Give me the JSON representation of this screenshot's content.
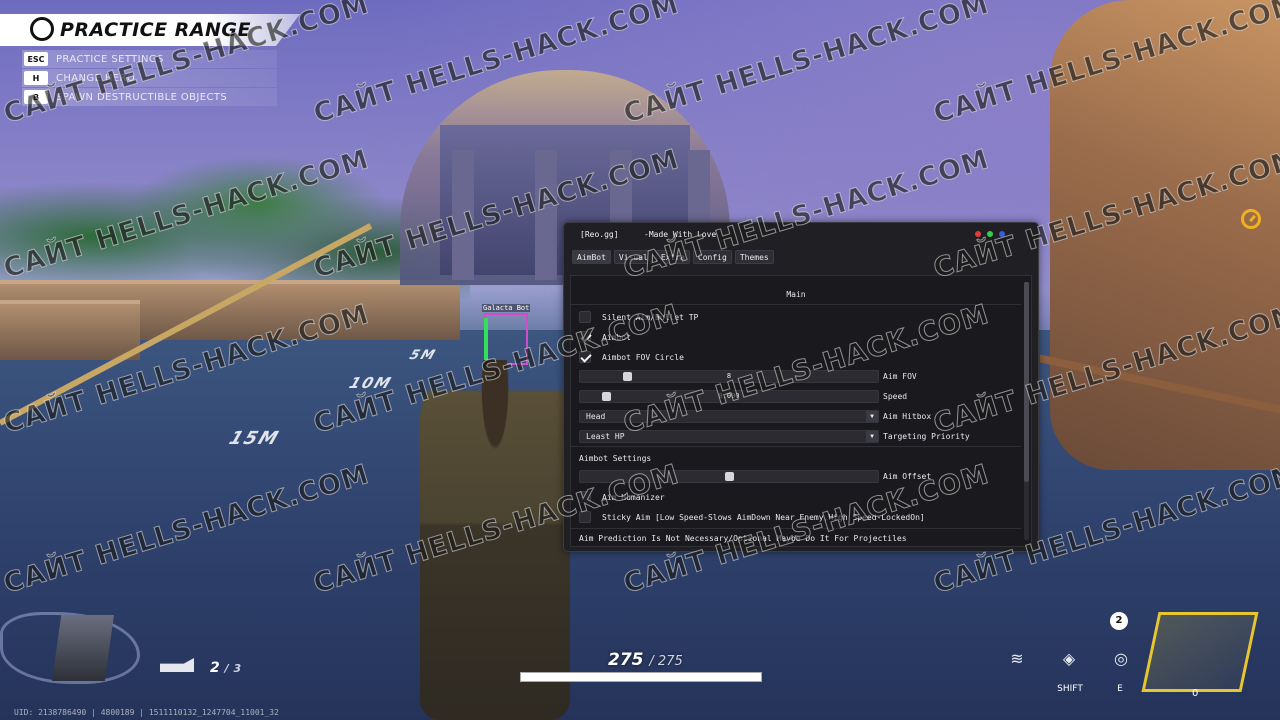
{
  "practice": {
    "title": "PRACTICE RANGE",
    "rows": [
      {
        "key": "ESC",
        "label": "PRACTICE SETTINGS"
      },
      {
        "key": "H",
        "label": "CHANGE HERO"
      },
      {
        "key": "B",
        "label": "SPAWN DESTRUCTIBLE OBJECTS"
      }
    ]
  },
  "floor_marks": {
    "m1": "5M",
    "m2": "10M",
    "m3": "15M"
  },
  "target": {
    "name": "Galacta Bot"
  },
  "menu": {
    "brand": "[Reo.gg]",
    "tagline": "-Made With Love",
    "dot_colors": {
      "red": "#e03a3a",
      "green": "#2fd04a",
      "blue": "#3a5ae0"
    },
    "tabs": [
      "AimBot",
      "Visual",
      "Extra",
      "Config",
      "Themes"
    ],
    "active_tab": "AimBot",
    "section_title": "Main",
    "silent_aim": {
      "label": "Silent Aim/Bullet TP",
      "checked": false
    },
    "aimbot": {
      "label": "Aimbot",
      "checked": true
    },
    "fov_circle": {
      "label": "Aimbot FOV Circle",
      "checked": true
    },
    "aim_fov": {
      "label": "Aim FOV",
      "value": "8"
    },
    "speed": {
      "label": "Speed",
      "value": "8.000"
    },
    "hitbox": {
      "label": "Aim Hitbox",
      "value": "Head"
    },
    "priority": {
      "label": "Targeting Priority",
      "value": "Least HP"
    },
    "settings_title": "Aimbot Settings",
    "aim_offset": {
      "label": "Aim Offset"
    },
    "humanizer": {
      "label": "Aim Humanizer",
      "checked": false
    },
    "sticky_aim": {
      "label": "Sticky Aim [Low Speed-Slows AimDown Near Enemy,High Speed-LockedOn]",
      "checked": false
    },
    "prediction_note": "Aim Prediction Is Not Necessary/Optional Maybe Do It For Projectiles"
  },
  "hud": {
    "hp": "275",
    "hp_max": "/ 275",
    "hp_fraction": 1.0,
    "ammo": "2",
    "ammo_sep": "/",
    "ammo_max": "3",
    "charge_count": "2",
    "ult_charge": "0",
    "ability_keys": [
      "SHIFT",
      "E"
    ],
    "uid": "UID: 2138786490 | 4800189 | 1511110132_1247704_11001_32"
  },
  "watermark_text": "САЙТ HELLS-HACK.COM"
}
